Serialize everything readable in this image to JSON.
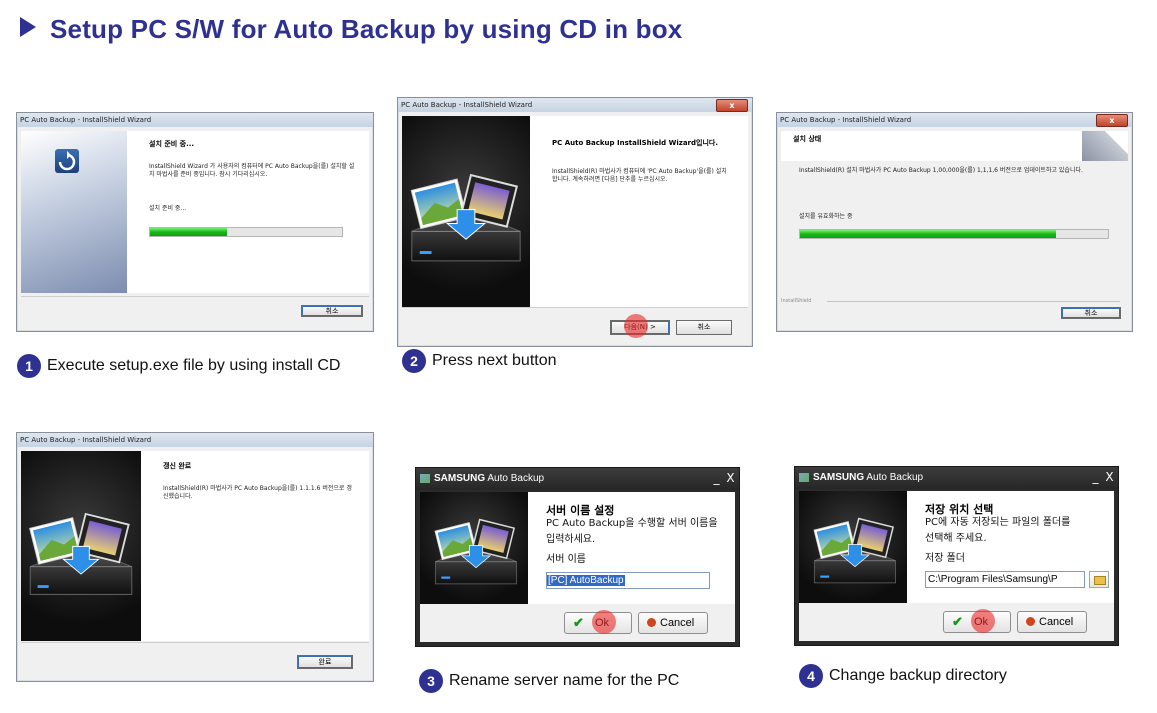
{
  "page": {
    "title": "Setup PC S/W for Auto Backup by using CD in box"
  },
  "steps": [
    {
      "num": "1",
      "caption": "Execute setup.exe file by using install CD"
    },
    {
      "num": "2",
      "caption": "Press next button"
    },
    {
      "num": "3",
      "caption": "Rename server name for the PC"
    },
    {
      "num": "4",
      "caption": "Change backup directory"
    }
  ],
  "win1": {
    "title": "PC Auto Backup - InstallShield Wizard",
    "heading": "설치 준비 중...",
    "desc": "InstallShield Wizard 가 사용자의 컴퓨터에 PC Auto Backup을(를) 설치할 설치 마법사를 준비 중입니다. 잠시 기다리십시오.",
    "status": "설치 준비 중...",
    "progress": 0.4,
    "cancel": "취소"
  },
  "win2": {
    "title": "PC Auto Backup - InstallShield Wizard",
    "close": "x",
    "heading": "PC Auto Backup InstallShield Wizard입니다.",
    "desc": "InstallShield(R) 마법사가 컴퓨터에 'PC Auto Backup'을(를) 설치합니다. 계속하려면 [다음] 단추를 누르십시오.",
    "next": "다음(N) >",
    "cancel": "취소"
  },
  "win3": {
    "title": "PC Auto Backup - InstallShield Wizard",
    "close": "x",
    "heading": "설치 상태",
    "desc": "InstallShield(R) 설치 마법사가 PC Auto Backup 1,00,000을(를) 1,1,1,6 버전으로 업데이트하고 있습니다.",
    "status": "설치를 유효화하는 중",
    "progress": 0.83,
    "brand": "InstallShield",
    "cancel": "취소"
  },
  "win4": {
    "title": "PC Auto Backup - InstallShield Wizard",
    "heading": "갱신 완료",
    "desc": "InstallShield(R) 마법사가 PC Auto Backup을(를) 1.1.1.6 버전으로 갱신했습니다.",
    "finish": "완료"
  },
  "dlg3": {
    "brand": "SAMSUNG",
    "app": "Auto Backup",
    "min": "_",
    "close": "X",
    "heading": "서버 이름 설정",
    "line1": "PC Auto Backup을 수행할 서버 이름을",
    "line2": "입력하세요.",
    "label": "서버 이름",
    "value": "[PC] AutoBackup",
    "ok": "Ok",
    "cancel": "Cancel"
  },
  "dlg4": {
    "brand": "SAMSUNG",
    "app": "Auto Backup",
    "min": "_",
    "close": "X",
    "heading": "저장 위치 선택",
    "line1": "PC에 자동 저장되는 파일의 폴더를",
    "line2": "선택해 주세요.",
    "label": "저장 폴더",
    "value": "C:\\Program Files\\Samsung\\P",
    "ok": "Ok",
    "cancel": "Cancel"
  },
  "colors": {
    "accent": "#2e3192",
    "progress": "#17b817",
    "click": "#eb2828"
  },
  "icons": [
    "triangle-arrow-icon",
    "installer-refresh-icon",
    "photo-drive-icon",
    "check-icon",
    "cancel-circle-icon",
    "folder-browse-icon"
  ]
}
